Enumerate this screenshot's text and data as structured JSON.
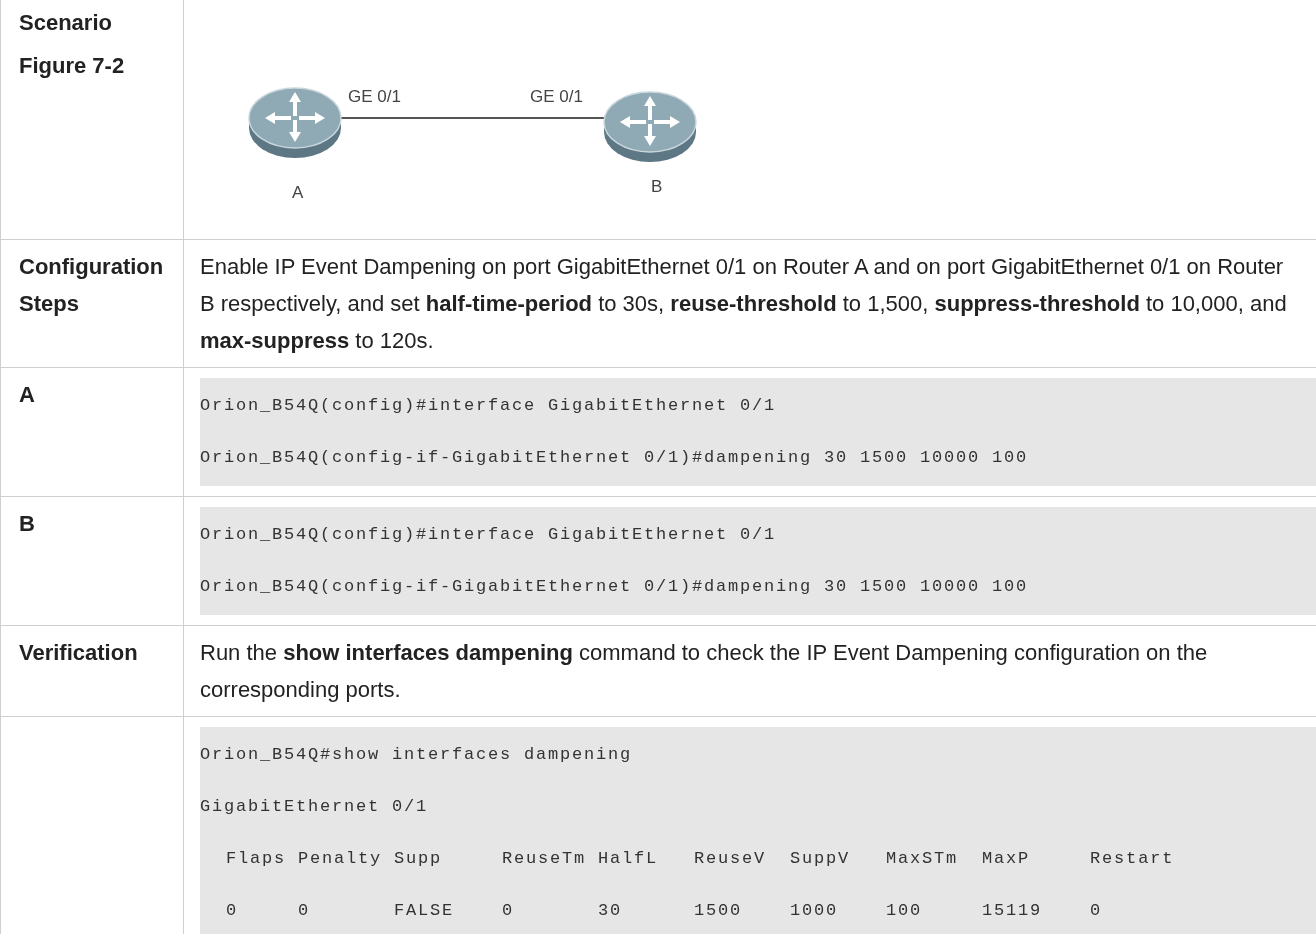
{
  "scenario": {
    "labels": [
      "Scenario",
      "Figure 7-2"
    ],
    "routers": [
      {
        "name": "A",
        "port": "GE 0/1"
      },
      {
        "name": "B",
        "port": "GE 0/1"
      }
    ]
  },
  "rows": [
    {
      "kind": "text",
      "label": "Configuration Steps",
      "text": "Enable IP Event Dampening on port GigabitEthernet 0/1 on Router A and on port GigabitEthernet 0/1 on Router B respectively, and set **half-time-period** to 30s, **reuse-threshold** to 1,500, **suppress-threshold** to 10,000, and **max-suppress** to 120s."
    },
    {
      "kind": "code",
      "label": "A",
      "lines": [
        "Orion_B54Q(config)#interface GigabitEthernet 0/1",
        "Orion_B54Q(config-if-GigabitEthernet 0/1)#dampening 30 1500 10000 100"
      ]
    },
    {
      "kind": "code",
      "label": "B",
      "lines": [
        "Orion_B54Q(config)#interface GigabitEthernet 0/1",
        "Orion_B54Q(config-if-GigabitEthernet 0/1)#dampening 30 1500 10000 100"
      ]
    },
    {
      "kind": "text",
      "label": "Verification",
      "text": "Run the **show interfaces dampening** command to check the IP Event Dampening configuration on the corresponding ports."
    },
    {
      "kind": "code",
      "lines": [
        "Orion_B54Q#show interfaces dampening",
        "GigabitEthernet 0/1",
        "Flaps Penalty Supp     ReuseTm HalfL   ReuseV  SuppV   MaxSTm  MaxP     Restart",
        "0     0       FALSE    0       30      1500    1000    100     15119    0"
      ]
    }
  ]
}
